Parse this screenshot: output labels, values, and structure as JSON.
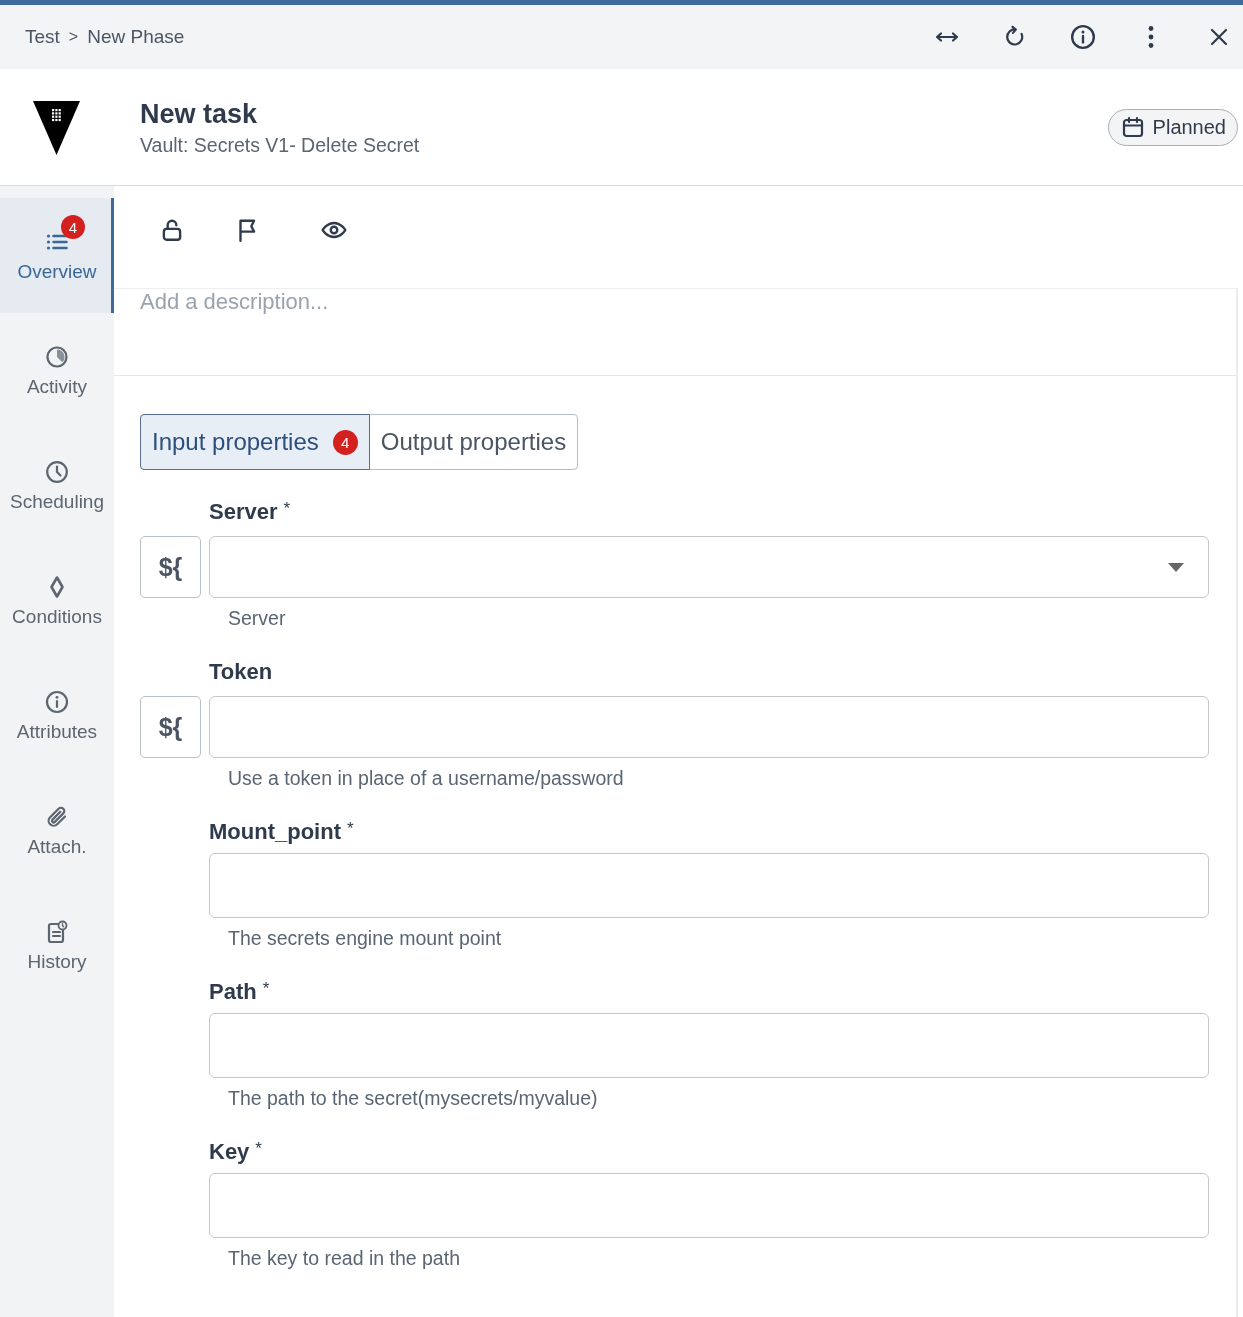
{
  "breadcrumb": {
    "items": [
      {
        "label": "Test"
      },
      {
        "label": "New Phase"
      }
    ],
    "separator": ">"
  },
  "task": {
    "title": "New task",
    "subtitle": "Vault: Secrets V1- Delete Secret",
    "status": "Planned"
  },
  "sidebar": {
    "items": [
      {
        "label": "Overview",
        "selected": true,
        "badge": "4"
      },
      {
        "label": "Activity",
        "selected": false
      },
      {
        "label": "Scheduling",
        "selected": false
      },
      {
        "label": "Conditions",
        "selected": false
      },
      {
        "label": "Attributes",
        "selected": false
      },
      {
        "label": "Attach.",
        "selected": false
      },
      {
        "label": "History",
        "selected": false
      }
    ]
  },
  "description": {
    "placeholder": "Add a description..."
  },
  "property_tabs": [
    {
      "label": "Input properties",
      "selected": true,
      "badge": "4"
    },
    {
      "label": "Output properties",
      "selected": false
    }
  ],
  "fields": [
    {
      "kind": "select",
      "label": "Server",
      "required_mark": "*",
      "expression_button": "${",
      "help": "Server"
    },
    {
      "kind": "text",
      "label": "Token",
      "expression_button": "${",
      "help": "Use a token in place of a username/password"
    },
    {
      "kind": "text",
      "label": "Mount_point",
      "required_mark": "*",
      "help": "The secrets engine mount point"
    },
    {
      "kind": "text",
      "label": "Path",
      "required_mark": "*",
      "help": "The path to the secret(mysecrets/myvalue)"
    },
    {
      "kind": "text",
      "label": "Key",
      "required_mark": "*",
      "help": "The key to read in the path"
    }
  ]
}
